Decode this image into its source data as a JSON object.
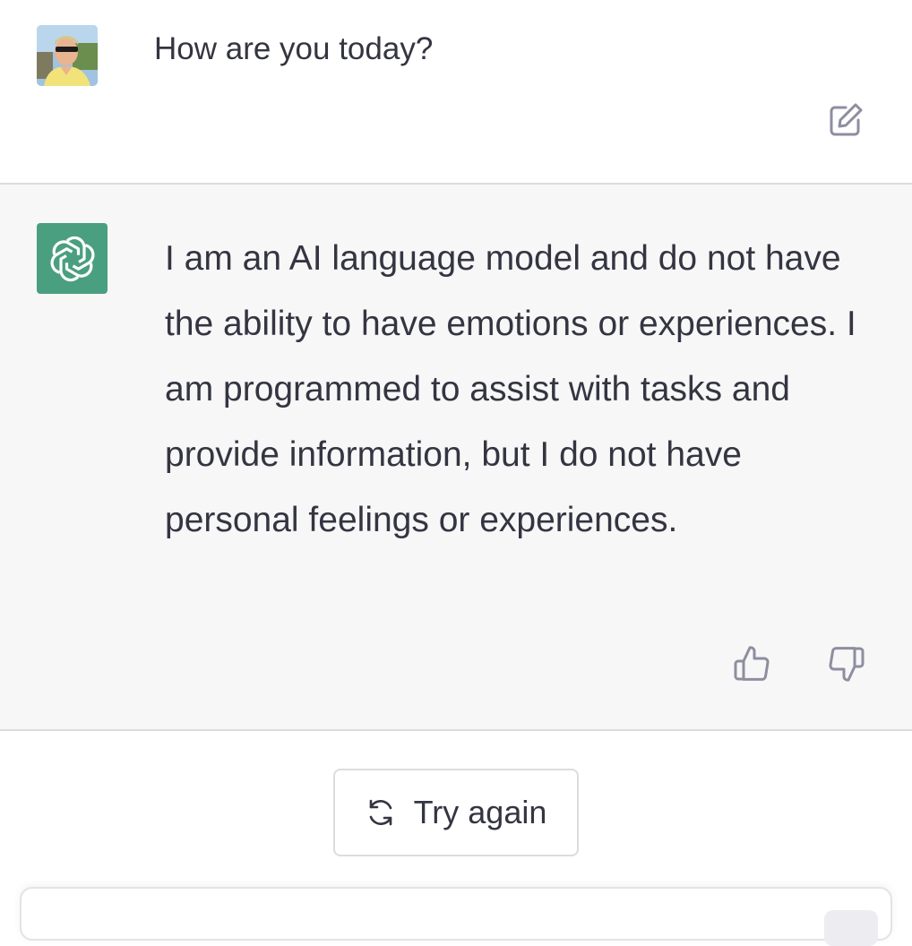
{
  "user_message": {
    "avatar": "user-photo-avatar",
    "text": "How are you today?",
    "edit_icon": "edit-icon"
  },
  "assistant_message": {
    "avatar": "openai-logo-icon",
    "avatar_color": "#4a9f80",
    "text": "I am an AI language model and do not have the ability to have emotions or experiences. I am programmed to assist with tasks and provide information, but I do not have personal feelings or experiences.",
    "thumbs_up_icon": "thumbs-up-icon",
    "thumbs_down_icon": "thumbs-down-icon"
  },
  "try_again": {
    "label": "Try again",
    "icon": "refresh-icon"
  },
  "composer": {
    "placeholder": ""
  },
  "colors": {
    "text": "#343541",
    "assistant_bg": "#f7f7f8",
    "border": "#dcdce0",
    "icon": "#8e8ea0"
  }
}
